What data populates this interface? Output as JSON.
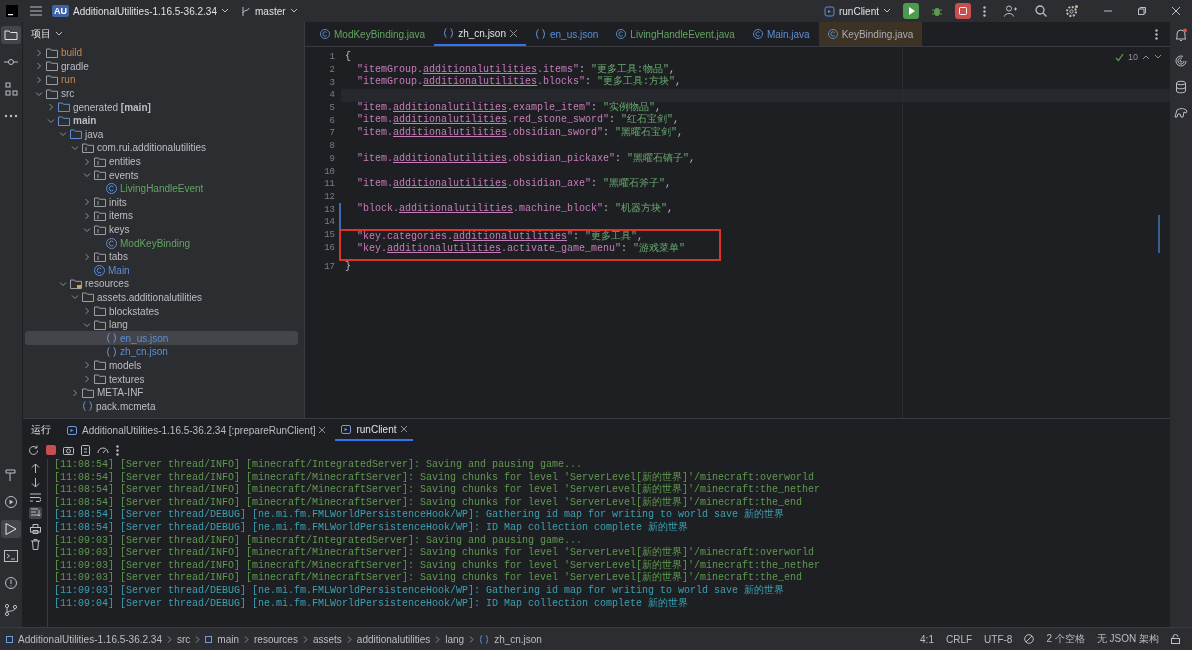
{
  "titlebar": {
    "project_badge": "AU",
    "project": "AdditionalUtilities-1.16.5-36.2.34",
    "branch": "master",
    "run_config": "runClient"
  },
  "project": {
    "title": "项目",
    "tree": [
      {
        "label": "build",
        "kind": "folder",
        "expanded": false,
        "selected": false,
        "excluded": true,
        "added": false,
        "modified": false
      },
      {
        "label": "gradle",
        "kind": "folder",
        "expanded": false,
        "selected": false,
        "excluded": false,
        "added": false,
        "modified": false
      },
      {
        "label": "run",
        "kind": "folder",
        "expanded": false,
        "selected": false,
        "excluded": true,
        "added": false,
        "modified": false
      },
      {
        "label": "src",
        "kind": "folder",
        "expanded": true,
        "selected": false,
        "excluded": false,
        "added": false,
        "modified": false,
        "children": [
          {
            "label": "generated **[main]**",
            "kind": "source_folder",
            "expanded": false,
            "selected": false,
            "excluded": false,
            "added": false,
            "modified": false
          },
          {
            "label": "main",
            "kind": "source_folder",
            "bold": true,
            "expanded": true,
            "selected": false,
            "excluded": false,
            "added": false,
            "modified": false,
            "children": [
              {
                "label": "java",
                "kind": "source_folder",
                "expanded": true,
                "selected": false,
                "excluded": false,
                "added": false,
                "modified": false,
                "children": [
                  {
                    "label": "com.rui.additionalutilities",
                    "kind": "package",
                    "expanded": true,
                    "selected": false,
                    "excluded": false,
                    "added": false,
                    "modified": false,
                    "children": [
                      {
                        "label": "entities",
                        "kind": "package",
                        "expanded": false,
                        "selected": false,
                        "excluded": false,
                        "added": false,
                        "modified": false
                      },
                      {
                        "label": "events",
                        "kind": "package",
                        "expanded": true,
                        "selected": false,
                        "excluded": false,
                        "added": false,
                        "modified": false,
                        "children": [
                          {
                            "label": "LivingHandleEvent",
                            "kind": "class",
                            "selected": false,
                            "excluded": false,
                            "added": true,
                            "modified": false
                          }
                        ]
                      },
                      {
                        "label": "inits",
                        "kind": "package",
                        "expanded": false,
                        "selected": false,
                        "excluded": false,
                        "added": false,
                        "modified": false
                      },
                      {
                        "label": "items",
                        "kind": "package",
                        "expanded": false,
                        "selected": false,
                        "excluded": false,
                        "added": false,
                        "modified": false
                      },
                      {
                        "label": "keys",
                        "kind": "package",
                        "expanded": true,
                        "selected": false,
                        "excluded": false,
                        "added": false,
                        "modified": false,
                        "children": [
                          {
                            "label": "ModKeyBinding",
                            "kind": "class",
                            "selected": false,
                            "excluded": false,
                            "added": true,
                            "modified": false
                          }
                        ]
                      },
                      {
                        "label": "tabs",
                        "kind": "package",
                        "expanded": false,
                        "selected": false,
                        "excluded": false,
                        "added": false,
                        "modified": false
                      },
                      {
                        "label": "Main",
                        "kind": "class",
                        "selected": false,
                        "excluded": false,
                        "added": false,
                        "modified": true
                      }
                    ]
                  }
                ]
              },
              {
                "label": "resources",
                "kind": "resource_folder",
                "expanded": true,
                "selected": false,
                "excluded": false,
                "added": false,
                "modified": false,
                "children": [
                  {
                    "label": "assets.additionalutilities",
                    "kind": "folder",
                    "expanded": true,
                    "selected": false,
                    "excluded": false,
                    "added": false,
                    "modified": false,
                    "children": [
                      {
                        "label": "blockstates",
                        "kind": "folder",
                        "expanded": false,
                        "selected": false,
                        "excluded": false,
                        "added": false,
                        "modified": false
                      },
                      {
                        "label": "lang",
                        "kind": "folder",
                        "expanded": true,
                        "selected": false,
                        "excluded": false,
                        "added": false,
                        "modified": false,
                        "children": [
                          {
                            "label": "en_us.json",
                            "kind": "json",
                            "selected": true,
                            "excluded": false,
                            "added": false,
                            "modified": true
                          },
                          {
                            "label": "zh_cn.json",
                            "kind": "json",
                            "selected": false,
                            "excluded": false,
                            "added": false,
                            "modified": true
                          }
                        ]
                      },
                      {
                        "label": "models",
                        "kind": "folder",
                        "expanded": false,
                        "selected": false,
                        "excluded": false,
                        "added": false,
                        "modified": false
                      },
                      {
                        "label": "textures",
                        "kind": "folder",
                        "expanded": false,
                        "selected": false,
                        "excluded": false,
                        "added": false,
                        "modified": false
                      }
                    ]
                  },
                  {
                    "label": "META-INF",
                    "kind": "folder",
                    "expanded": false,
                    "selected": false,
                    "excluded": false,
                    "added": false,
                    "modified": false
                  },
                  {
                    "label": "pack.mcmeta",
                    "kind": "json",
                    "selected": false,
                    "excluded": false,
                    "added": false,
                    "modified": false
                  }
                ]
              }
            ]
          }
        ]
      }
    ]
  },
  "editor": {
    "tabs": [
      {
        "label": "ModKeyBinding.java",
        "kind": "java",
        "selected": false,
        "added": true,
        "modified": false,
        "readonly": false
      },
      {
        "label": "zh_cn.json",
        "kind": "json",
        "selected": true,
        "added": false,
        "modified": false,
        "readonly": false
      },
      {
        "label": "en_us.json",
        "kind": "json",
        "selected": false,
        "added": false,
        "modified": true,
        "readonly": false
      },
      {
        "label": "LivingHandleEvent.java",
        "kind": "java",
        "selected": false,
        "added": true,
        "modified": false,
        "readonly": false
      },
      {
        "label": "Main.java",
        "kind": "java",
        "selected": false,
        "added": false,
        "modified": true,
        "readonly": false
      },
      {
        "label": "KeyBinding.java",
        "kind": "java",
        "selected": false,
        "added": false,
        "modified": false,
        "readonly": true
      }
    ],
    "inspection_count": "10",
    "lines": [
      {
        "number": "1",
        "tokens": [
          {
            "kind": "punct",
            "text": "{"
          }
        ]
      },
      {
        "number": "2",
        "tokens": [
          {
            "kind": "key",
            "text": "  \"itemGroup."
          },
          {
            "kind": "key_link",
            "text": "additionalutilities"
          },
          {
            "kind": "key",
            "text": ".items\""
          },
          {
            "kind": "punct",
            "text": ": "
          },
          {
            "kind": "string",
            "text": "\"更多工具:物品\""
          },
          {
            "kind": "punct",
            "text": ","
          }
        ]
      },
      {
        "number": "3",
        "tokens": [
          {
            "kind": "key",
            "text": "  \"itemGroup."
          },
          {
            "kind": "key_link",
            "text": "additionalutilities"
          },
          {
            "kind": "key",
            "text": ".blocks\""
          },
          {
            "kind": "punct",
            "text": ": "
          },
          {
            "kind": "string",
            "text": "\"更多工具:方块\""
          },
          {
            "kind": "punct",
            "text": ","
          }
        ]
      },
      {
        "number": "4",
        "current": true
      },
      {
        "number": "5",
        "tokens": [
          {
            "kind": "key",
            "text": "  \"item."
          },
          {
            "kind": "key_link",
            "text": "additionalutilities"
          },
          {
            "kind": "key",
            "text": ".example_item\""
          },
          {
            "kind": "punct",
            "text": ": "
          },
          {
            "kind": "string",
            "text": "\"实例物品\""
          },
          {
            "kind": "punct",
            "text": ","
          }
        ]
      },
      {
        "number": "6",
        "tokens": [
          {
            "kind": "key",
            "text": "  \"item."
          },
          {
            "kind": "key_link",
            "text": "additionalutilities"
          },
          {
            "kind": "key",
            "text": ".red_stone_sword\""
          },
          {
            "kind": "punct",
            "text": ": "
          },
          {
            "kind": "string",
            "text": "\"红石宝剑\""
          },
          {
            "kind": "punct",
            "text": ","
          }
        ]
      },
      {
        "number": "7",
        "tokens": [
          {
            "kind": "key",
            "text": "  \"item."
          },
          {
            "kind": "key_link",
            "text": "additionalutilities"
          },
          {
            "kind": "key",
            "text": ".obsidian_sword\""
          },
          {
            "kind": "punct",
            "text": ": "
          },
          {
            "kind": "string",
            "text": "\"黑曜石宝剑\""
          },
          {
            "kind": "punct",
            "text": ","
          }
        ]
      },
      {
        "number": "8"
      },
      {
        "number": "9",
        "tokens": [
          {
            "kind": "key",
            "text": "  \"item."
          },
          {
            "kind": "key_link",
            "text": "additionalutilities"
          },
          {
            "kind": "key",
            "text": ".obsidian_pickaxe\""
          },
          {
            "kind": "punct",
            "text": ": "
          },
          {
            "kind": "string",
            "text": "\"黑曜石镐子\""
          },
          {
            "kind": "punct",
            "text": ","
          }
        ]
      },
      {
        "number": "10"
      },
      {
        "number": "11",
        "tokens": [
          {
            "kind": "key",
            "text": "  \"item."
          },
          {
            "kind": "key_link",
            "text": "additionalutilities"
          },
          {
            "kind": "key",
            "text": ".obsidian_axe\""
          },
          {
            "kind": "punct",
            "text": ": "
          },
          {
            "kind": "string",
            "text": "\"黑曜石斧子\""
          },
          {
            "kind": "punct",
            "text": ","
          }
        ]
      },
      {
        "number": "12"
      },
      {
        "number": "13",
        "changed": true,
        "tokens": [
          {
            "kind": "key",
            "text": "  \"block."
          },
          {
            "kind": "key_link",
            "text": "additionalutilities"
          },
          {
            "kind": "key",
            "text": ".machine_block\""
          },
          {
            "kind": "punct",
            "text": ": "
          },
          {
            "kind": "string",
            "text": "\"机器方块\""
          },
          {
            "kind": "punct",
            "text": ","
          }
        ]
      },
      {
        "number": "14",
        "changed": true
      },
      {
        "number": "15",
        "changed": true,
        "boxed": true,
        "tokens": [
          {
            "kind": "key",
            "text": "  \"key.categories."
          },
          {
            "kind": "key_link",
            "text": "additionalutilities"
          },
          {
            "kind": "key",
            "text": "\""
          },
          {
            "kind": "punct",
            "text": ": "
          },
          {
            "kind": "string",
            "text": "\"更多工具\""
          },
          {
            "kind": "punct",
            "text": ","
          }
        ]
      },
      {
        "number": "16",
        "changed": true,
        "boxed": true,
        "tokens": [
          {
            "kind": "key",
            "text": "  \"key."
          },
          {
            "kind": "key_link",
            "text": "additionalutilities"
          },
          {
            "kind": "key",
            "text": ".activate_game_menu\""
          },
          {
            "kind": "punct",
            "text": ": "
          },
          {
            "kind": "string",
            "text": "\"游戏菜单\""
          }
        ]
      },
      {
        "number": "17",
        "tokens": [
          {
            "kind": "punct",
            "text": "}"
          }
        ]
      }
    ]
  },
  "run": {
    "title": "运行",
    "tabs": [
      {
        "label": "AdditionalUtilities-1.16.5-36.2.34 [:prepareRunClient]",
        "selected": false
      },
      {
        "label": "runClient",
        "selected": true
      }
    ],
    "console": [
      {
        "kind": "info",
        "text": "[11:08:54] [Server thread/INFO] [minecraft/IntegratedServer]: Saving and pausing game..."
      },
      {
        "kind": "info",
        "text": "[11:08:54] [Server thread/INFO] [minecraft/MinecraftServer]: Saving chunks for level 'ServerLevel[新的世界]'/minecraft:overworld"
      },
      {
        "kind": "info",
        "text": "[11:08:54] [Server thread/INFO] [minecraft/MinecraftServer]: Saving chunks for level 'ServerLevel[新的世界]'/minecraft:the_nether"
      },
      {
        "kind": "info",
        "text": "[11:08:54] [Server thread/INFO] [minecraft/MinecraftServer]: Saving chunks for level 'ServerLevel[新的世界]'/minecraft:the_end"
      },
      {
        "kind": "debug",
        "text": "[11:08:54] [Server thread/DEBUG] [ne.mi.fm.FMLWorldPersistenceHook/WP]: Gathering id map for writing to world save 新的世界"
      },
      {
        "kind": "debug",
        "text": "[11:08:54] [Server thread/DEBUG] [ne.mi.fm.FMLWorldPersistenceHook/WP]: ID Map collection complete 新的世界"
      },
      {
        "kind": "info",
        "text": "[11:09:03] [Server thread/INFO] [minecraft/IntegratedServer]: Saving and pausing game..."
      },
      {
        "kind": "info",
        "text": "[11:09:03] [Server thread/INFO] [minecraft/MinecraftServer]: Saving chunks for level 'ServerLevel[新的世界]'/minecraft:overworld"
      },
      {
        "kind": "info",
        "text": "[11:09:03] [Server thread/INFO] [minecraft/MinecraftServer]: Saving chunks for level 'ServerLevel[新的世界]'/minecraft:the_nether"
      },
      {
        "kind": "info",
        "text": "[11:09:03] [Server thread/INFO] [minecraft/MinecraftServer]: Saving chunks for level 'ServerLevel[新的世界]'/minecraft:the_end"
      },
      {
        "kind": "debug",
        "text": "[11:09:03] [Server thread/DEBUG] [ne.mi.fm.FMLWorldPersistenceHook/WP]: Gathering id map for writing to world save 新的世界"
      },
      {
        "kind": "debug",
        "text": "[11:09:04] [Server thread/DEBUG] [ne.mi.fm.FMLWorldPersistenceHook/WP]: ID Map collection complete 新的世界"
      }
    ]
  },
  "status_bar": {
    "breadcrumbs": [
      {
        "label": "AdditionalUtilities-1.16.5-36.2.34",
        "kind": "module"
      },
      {
        "label": "src",
        "kind": "folder"
      },
      {
        "label": "main",
        "kind": "module"
      },
      {
        "label": "resources",
        "kind": "folder"
      },
      {
        "label": "assets",
        "kind": "folder"
      },
      {
        "label": "additionalutilities",
        "kind": "folder"
      },
      {
        "label": "lang",
        "kind": "folder"
      },
      {
        "label": "zh_cn.json",
        "kind": "json"
      }
    ],
    "position": "4:1",
    "line_ending": "CRLF",
    "encoding": "UTF-8",
    "indent": "2 个空格",
    "schema": "无 JSON 架构"
  }
}
